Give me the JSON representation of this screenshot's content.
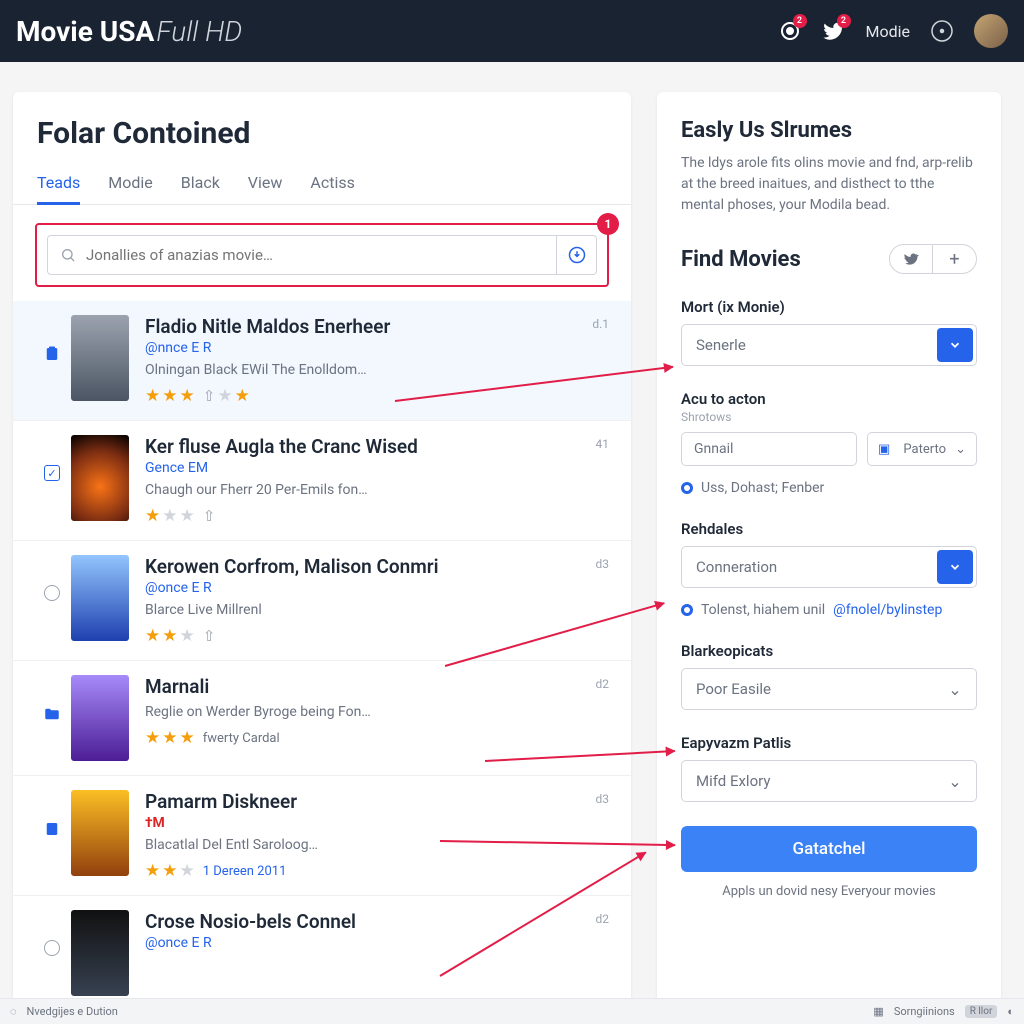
{
  "header": {
    "brand_main": "Movie USA",
    "brand_sub": "Full HD",
    "notif_badge_1": "2",
    "notif_badge_2": "2",
    "modie_label": "Modie"
  },
  "left": {
    "title": "Folar Contoined",
    "tabs": [
      "Teads",
      "Modie",
      "Black",
      "View",
      "Actiss"
    ],
    "search_placeholder": "Jonallies of anazias movie…",
    "search_badge": "1",
    "items": [
      {
        "title": "Fladio Nitle Maldos Enerheer",
        "sub": "@nnce E R",
        "desc": "Olningan Black EWil The Enolldom…",
        "code": "d.1",
        "stars": 3.5
      },
      {
        "title": "Ker fluse Augla the Cranc Wised",
        "sub": "Gence EM",
        "desc": "Chaugh our Fherr 20 Per-Emils fon…",
        "code": "41",
        "stars": 1.5
      },
      {
        "title": "Kerowen Corfrom, Malison Conmri",
        "sub": "@once E R",
        "desc": "Blarce Live Millrenl",
        "code": "d3",
        "stars": 2
      },
      {
        "title": "Marnali",
        "sub": "",
        "desc": "Reglie on Werder Byroge being Fon…",
        "code": "d2",
        "stars": 3,
        "extra": "fwerty Cardal"
      },
      {
        "title": "Pamarm Diskneer",
        "sub": "†M",
        "desc": "Blacatlal Del Entl Saroloog…",
        "code": "d3",
        "stars": 2,
        "extra": "1 Dereen 2011"
      },
      {
        "title": "Crose Nosio-bels Connel",
        "sub": "@once E R",
        "desc": "",
        "code": "d2",
        "stars": 0
      }
    ]
  },
  "right": {
    "h1": "Easly Us Slrumes",
    "body": "The ldys arole fits olins movie and fnd, arp-relib at the breed inaitues, and disthect to tthe mental phoses, your Modila bead.",
    "find": "Find Movies",
    "f1_label": "Mort (ix Monie)",
    "f1_value": "Senerle",
    "f2_label": "Acu to acton",
    "f2_sub": "Shrotows",
    "f2_input": "Gnnail",
    "f2_select": "Paterto",
    "radio1": "Uss, Dohast; Fenber",
    "f3_label": "Rehdales",
    "f3_value": "Conneration",
    "radio2_a": "Tolenst, hiahem unil ",
    "radio2_b": "@fnolel/bylinstep",
    "f4_label": "Blarkeopicats",
    "f4_value": "Poor Easile",
    "f5_label": "Eapyvazm Patlis",
    "f5_value": "Mifd Exlory",
    "button": "Gatatchel",
    "footer": "Appls un dovid nesy Everyour movies"
  },
  "status": {
    "left1": "Nvedgijes e Dution",
    "right1": "Sorngiinions",
    "right2": "R llor"
  }
}
